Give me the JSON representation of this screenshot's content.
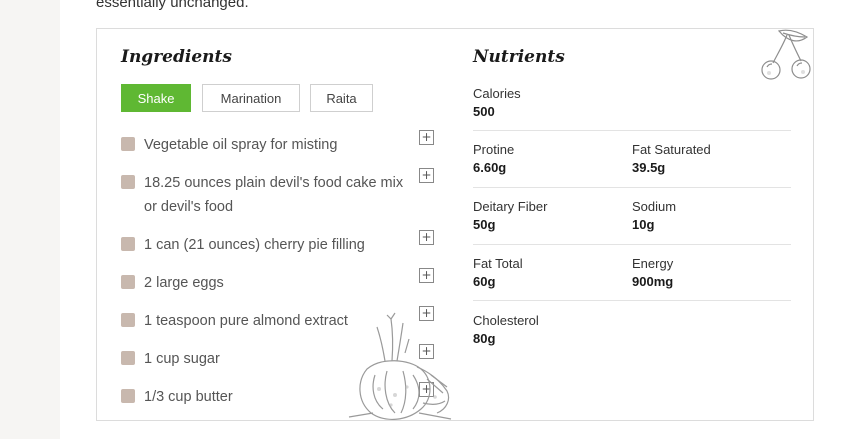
{
  "intro": {
    "text": "essentially unchanged."
  },
  "ingredients": {
    "heading": "Ingredients",
    "tabs": [
      {
        "label": "Shake",
        "active": true
      },
      {
        "label": "Marination",
        "active": false
      },
      {
        "label": "Raita",
        "active": false
      }
    ],
    "items": [
      {
        "text": "Vegetable oil spray for misting"
      },
      {
        "text": "18.25 ounces plain devil's food cake mix or devil's food"
      },
      {
        "text": "1 can (21 ounces) cherry pie filling"
      },
      {
        "text": "2 large eggs"
      },
      {
        "text": "1 teaspoon pure almond extract"
      },
      {
        "text": "1 cup sugar"
      },
      {
        "text": "1/3 cup butter"
      }
    ],
    "add_icon": "plus-icon"
  },
  "nutrients": {
    "heading": "Nutrients",
    "calories": {
      "label": "Calories",
      "value": "500"
    },
    "protine": {
      "label": "Protine",
      "value": "6.60g"
    },
    "fat_saturated": {
      "label": "Fat Saturated",
      "value": "39.5g"
    },
    "dietary_fiber": {
      "label": "Deitary Fiber",
      "value": "50g"
    },
    "sodium": {
      "label": "Sodium",
      "value": "10g"
    },
    "fat_total": {
      "label": "Fat Total",
      "value": "60g"
    },
    "energy": {
      "label": "Energy",
      "value": "900mg"
    },
    "cholesterol": {
      "label": "Cholesterol",
      "value": "80g"
    }
  },
  "colors": {
    "accent": "#5fb833",
    "checkbox": "#c8b8ae"
  }
}
